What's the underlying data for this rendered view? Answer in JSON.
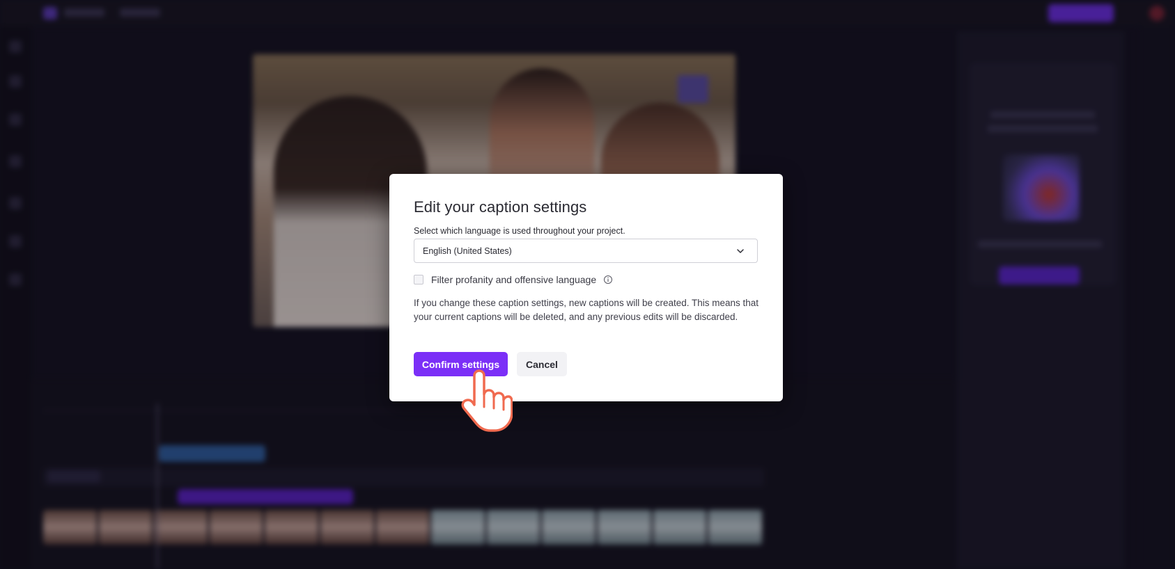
{
  "modal": {
    "title": "Edit your caption settings",
    "language_label": "Select which language is used throughout your project.",
    "language_value": "English (United States)",
    "filter_label": "Filter profanity and offensive language",
    "filter_checked": false,
    "warning": "If you change these caption settings, new captions will be created. This means that your current captions will be deleted, and any previous edits will be discarded.",
    "confirm_label": "Confirm settings",
    "cancel_label": "Cancel"
  },
  "icons": {
    "select_chevron": "chevron-down-icon",
    "filter_info": "info-icon",
    "pointer": "hand-pointer-cursor-icon"
  },
  "colors": {
    "accent": "#7b2ff7",
    "backdrop": "#14121f",
    "modal_bg": "#ffffff",
    "cursor_outline": "#f06a4f"
  }
}
